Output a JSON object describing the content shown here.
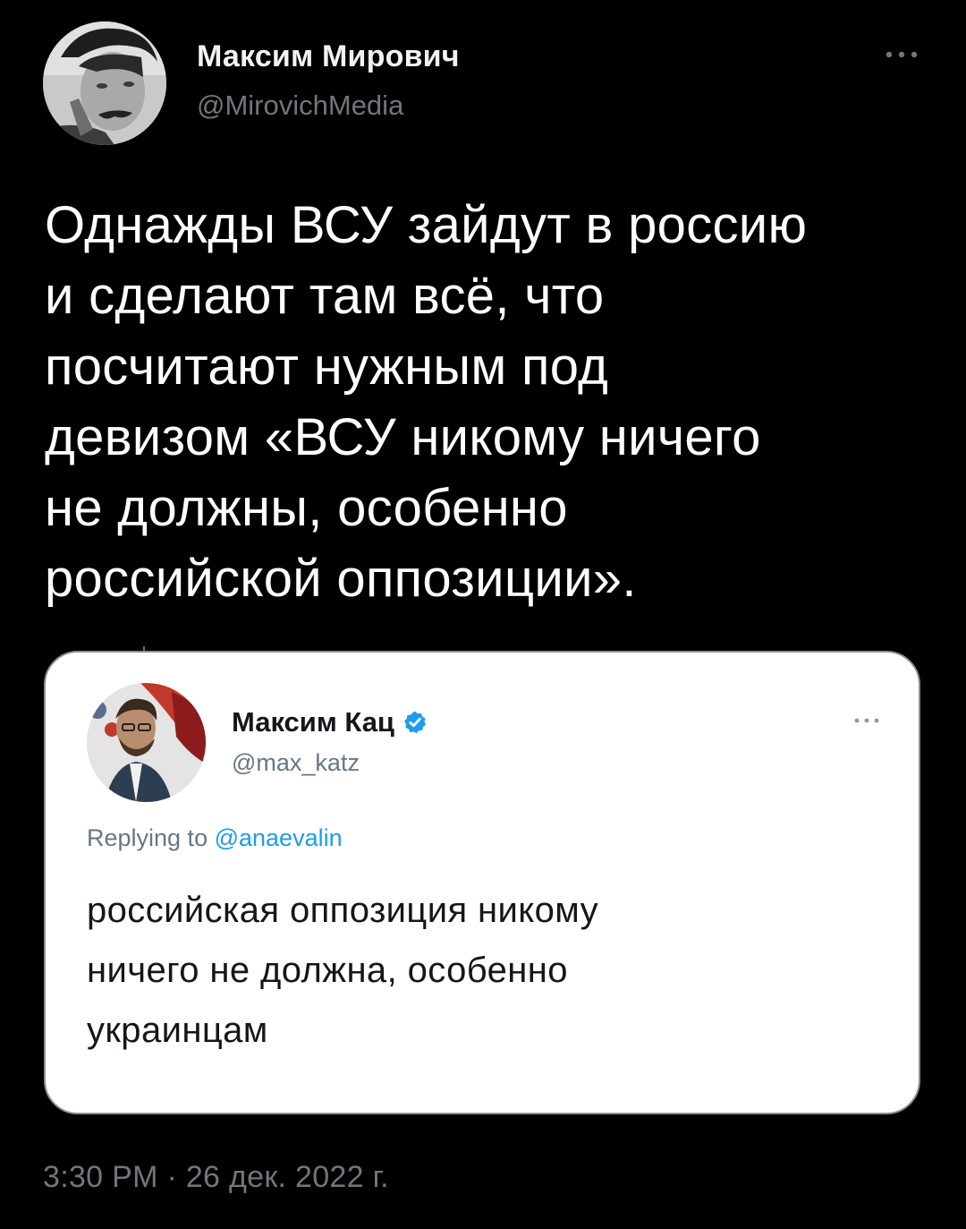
{
  "tweet": {
    "author": {
      "name": "Максим Мирович",
      "handle": "@MirovichMedia"
    },
    "text": "Однажды ВСУ зайдут в россию\nи сделают там всё, что\nпосчитают нужным под\nдевизом «ВСУ никому ничего\nне должны, особенно\nроссийской оппозиции».",
    "timestamp": "3:30 PM · 26 дек. 2022 г."
  },
  "quote": {
    "author": {
      "name": "Максим Кац",
      "handle": "@max_katz",
      "verified": true
    },
    "reply_prefix": "Replying to ",
    "reply_to": "@anaevalin",
    "text": "российская оппозиция никому\nничего не должна, особенно\nукраинцам"
  },
  "icons": {
    "more": "more-horizontal-icon",
    "verified": "verified-badge-icon"
  },
  "colors": {
    "background": "#000000",
    "secondary_text": "#71767b",
    "link": "#1d9bf0",
    "verified": "#1d9bf0",
    "card_background": "#ffffff"
  }
}
